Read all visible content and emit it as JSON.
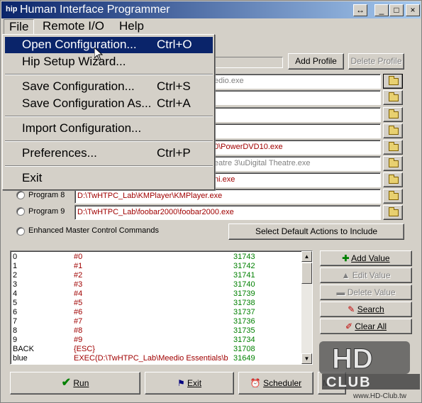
{
  "window": {
    "title": "Human Interface Programmer",
    "app_icon": "hip",
    "controls": [
      "↔",
      "_",
      "□",
      "×"
    ]
  },
  "menubar": {
    "file": "File",
    "remote": "Remote I/O",
    "help": "Help"
  },
  "file_menu": [
    {
      "label": "Open Configuration...",
      "shortcut": "Ctrl+O"
    },
    {
      "label": "Hip Setup Wizard...",
      "shortcut": ""
    },
    {
      "label": "Save Configuration...",
      "shortcut": "Ctrl+S"
    },
    {
      "label": "Save Configuration As...",
      "shortcut": "Ctrl+A"
    },
    {
      "label": "Import Configuration...",
      "shortcut": ""
    },
    {
      "label": "Preferences...",
      "shortcut": "Ctrl+P"
    },
    {
      "label": "Exit",
      "shortcut": ""
    }
  ],
  "profile": {
    "add": "Add Profile",
    "delete": "Delete Profile"
  },
  "programs": [
    {
      "value": "edio.exe"
    },
    {
      "value": ""
    },
    {
      "value": ""
    },
    {
      "value": ""
    },
    {
      "value": "0\\PowerDVD10.exe"
    },
    {
      "value": "eatre 3\\uDigital Theatre.exe"
    },
    {
      "value": "ni.exe"
    },
    {
      "label": "Program 8",
      "value": "D:\\TwHTPC_Lab\\KMPlayer\\KMPlayer.exe"
    },
    {
      "label": "Program 9",
      "value": "D:\\TwHTPC_Lab\\foobar2000\\foobar2000.exe"
    }
  ],
  "enhanced": {
    "label": "Enhanced Master Control Commands",
    "button": "Select Default Actions to Include"
  },
  "list": [
    [
      "0",
      "#0",
      "31743"
    ],
    [
      "1",
      "#1",
      "31742"
    ],
    [
      "2",
      "#2",
      "31741"
    ],
    [
      "3",
      "#3",
      "31740"
    ],
    [
      "4",
      "#4",
      "31739"
    ],
    [
      "5",
      "#5",
      "31738"
    ],
    [
      "6",
      "#6",
      "31737"
    ],
    [
      "7",
      "#7",
      "31736"
    ],
    [
      "8",
      "#8",
      "31735"
    ],
    [
      "9",
      "#9",
      "31734"
    ],
    [
      "BACK",
      "{ESC}",
      "31708"
    ],
    [
      "blue",
      "EXEC(D:\\TwHTPC_Lab\\Meedio Essentials\\ba",
      "31649"
    ]
  ],
  "side": {
    "add": "Add Value",
    "edit": "Edit Value",
    "delete": "Delete Value",
    "search": "Search",
    "clear": "Clear All"
  },
  "bottom": {
    "run": "Run",
    "exit": "Exit",
    "scheduler": "Scheduler",
    "minimize": "M"
  },
  "watermark": {
    "brand": "HD CLUB",
    "url": "www.HD-Club.tw"
  },
  "colors": {
    "title_start": "#0a246a",
    "title_end": "#a6caf0",
    "path_red": "#a00000",
    "value_green": "#008000"
  }
}
